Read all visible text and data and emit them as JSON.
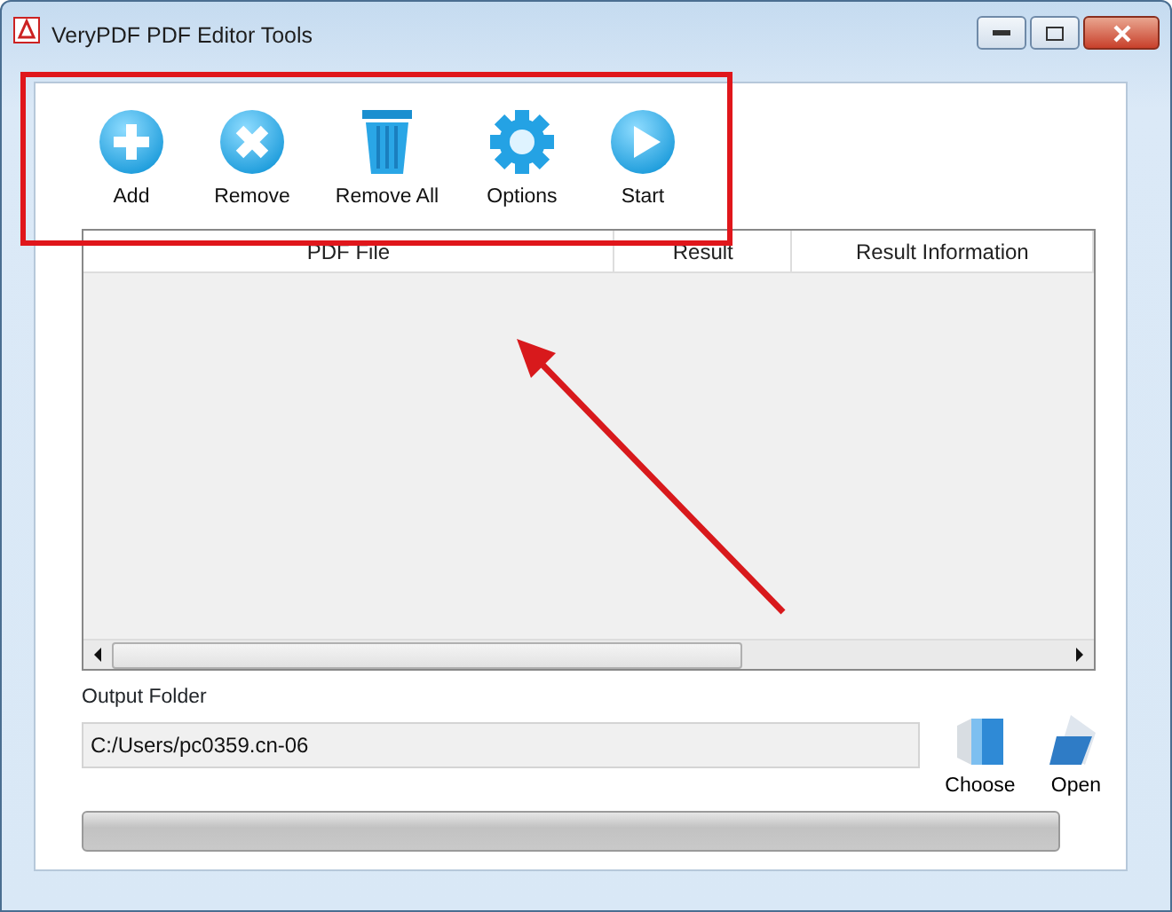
{
  "window": {
    "title": "VeryPDF PDF Editor Tools"
  },
  "toolbar": [
    {
      "kind": "add",
      "label": "Add"
    },
    {
      "kind": "remove",
      "label": "Remove"
    },
    {
      "kind": "remove-all",
      "label": "Remove All"
    },
    {
      "kind": "options",
      "label": "Options"
    },
    {
      "kind": "start",
      "label": "Start"
    }
  ],
  "table": {
    "columns": [
      "PDF File",
      "Result",
      "Result Information"
    ]
  },
  "output": {
    "label": "Output Folder",
    "value": "C:/Users/pc0359.cn-06",
    "buttons": [
      {
        "kind": "choose",
        "label": "Choose"
      },
      {
        "kind": "open",
        "label": "Open"
      }
    ]
  },
  "progress": {
    "level": 0
  }
}
